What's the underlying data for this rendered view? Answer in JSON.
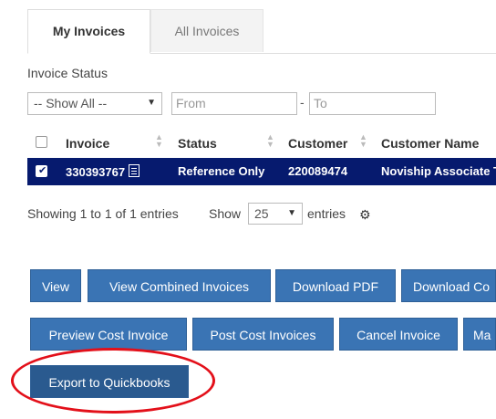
{
  "tabs": {
    "my_invoices": "My Invoices",
    "all_invoices": "All Invoices"
  },
  "filters": {
    "status_label": "Invoice Status",
    "status_selected": "-- Show All --",
    "from_placeholder": "From",
    "dash": "-",
    "to_placeholder": "To"
  },
  "table": {
    "columns": [
      "Invoice",
      "Status",
      "Customer",
      "Customer Name"
    ],
    "rows": [
      {
        "invoice": "330393767",
        "status": "Reference Only",
        "customer": "220089474",
        "customer_name": "Noviship Associate To"
      }
    ]
  },
  "pagination": {
    "info": "Showing 1 to 1 of 1 entries",
    "show_label": "Show",
    "page_size": "25",
    "entries_label": "entries"
  },
  "actions": {
    "row1": [
      "View",
      "View Combined Invoices",
      "Download PDF",
      "Download Co"
    ],
    "row2": [
      "Preview Cost Invoice",
      "Post Cost Invoices",
      "Cancel Invoice",
      "Ma"
    ],
    "export": "Export to Quickbooks"
  },
  "colors": {
    "selected_row": "#061a6e",
    "button": "#3a74b4",
    "highlight": "#e3101a"
  }
}
